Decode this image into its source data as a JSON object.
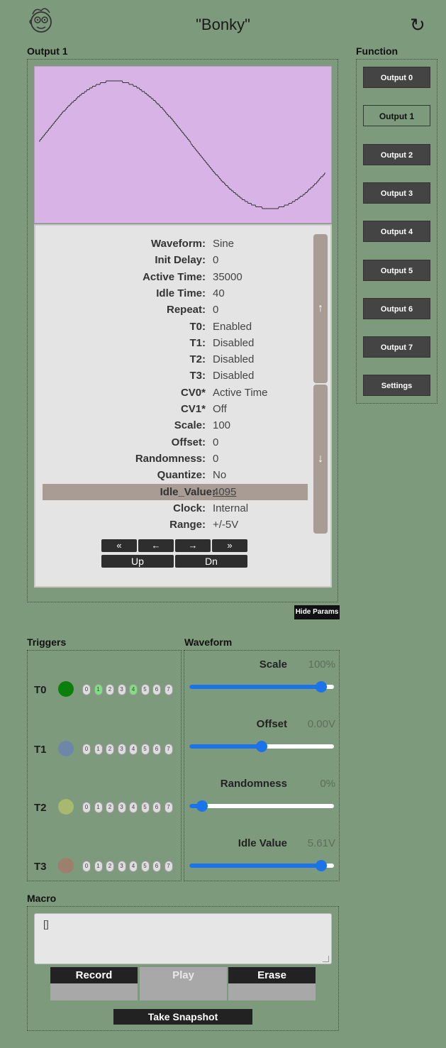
{
  "header": {
    "title": "\"Bonky\"",
    "logo_icon": "face-logo-icon",
    "refresh_icon": "refresh-icon"
  },
  "output_panel": {
    "title": "Output 1",
    "waveform_color": "#d7b3e6",
    "params": [
      {
        "label": "Waveform:",
        "value": "Sine"
      },
      {
        "label": "Init Delay:",
        "value": "0"
      },
      {
        "label": "Active Time:",
        "value": "35000"
      },
      {
        "label": "Idle Time:",
        "value": "40"
      },
      {
        "label": "Repeat:",
        "value": "0"
      },
      {
        "label": "T0:",
        "value": "Enabled"
      },
      {
        "label": "T1:",
        "value": "Disabled"
      },
      {
        "label": "T2:",
        "value": "Disabled"
      },
      {
        "label": "T3:",
        "value": "Disabled"
      },
      {
        "label": "CV0*",
        "value": "Active Time"
      },
      {
        "label": "CV1*",
        "value": "Off"
      },
      {
        "label": "Scale:",
        "value": "100"
      },
      {
        "label": "Offset:",
        "value": "0"
      },
      {
        "label": "Randomness:",
        "value": "0"
      },
      {
        "label": "Quantize:",
        "value": "No"
      },
      {
        "label": "Idle_Value:",
        "value": "4095",
        "selected": true
      },
      {
        "label": "Clock:",
        "value": "Internal"
      },
      {
        "label": "Range:",
        "value": "+/-5V"
      }
    ],
    "scroll_up_label": "↑",
    "scroll_down_label": "↓",
    "nav": {
      "first": "«",
      "prev": "←",
      "next": "→",
      "last": "»",
      "up": "Up",
      "dn": "Dn"
    },
    "hide_params_label": "Hide Params"
  },
  "function": {
    "title": "Function",
    "items": [
      {
        "label": "Output 0",
        "active": false
      },
      {
        "label": "Output 1",
        "active": true
      },
      {
        "label": "Output 2",
        "active": false
      },
      {
        "label": "Output 3",
        "active": false
      },
      {
        "label": "Output 4",
        "active": false
      },
      {
        "label": "Output 5",
        "active": false
      },
      {
        "label": "Output 6",
        "active": false
      },
      {
        "label": "Output 7",
        "active": false
      },
      {
        "label": "Settings",
        "active": false
      }
    ]
  },
  "triggers": {
    "title": "Triggers",
    "rows": [
      {
        "label": "T0",
        "color": "#0b7f0b",
        "active_steps": [
          1,
          4
        ]
      },
      {
        "label": "T1",
        "color": "#6f86a8",
        "active_steps": []
      },
      {
        "label": "T2",
        "color": "#a7b96f",
        "active_steps": []
      },
      {
        "label": "T3",
        "color": "#9d7f6d",
        "active_steps": []
      }
    ],
    "steps": [
      "0",
      "1",
      "2",
      "3",
      "4",
      "5",
      "6",
      "7"
    ]
  },
  "waveform": {
    "title": "Waveform",
    "sliders": [
      {
        "label": "Scale",
        "value": "100%",
        "fraction": 0.91
      },
      {
        "label": "Offset",
        "value": "0.00V",
        "fraction": 0.5
      },
      {
        "label": "Randomness",
        "value": "0%",
        "fraction": 0.09
      },
      {
        "label": "Idle Value",
        "value": "5.61V",
        "fraction": 0.91
      }
    ],
    "accent_color": "#1a73e8"
  },
  "macro": {
    "title": "Macro",
    "text": "[]",
    "record_label": "Record",
    "play_label": "Play",
    "erase_label": "Erase",
    "snapshot_label": "Take Snapshot"
  }
}
